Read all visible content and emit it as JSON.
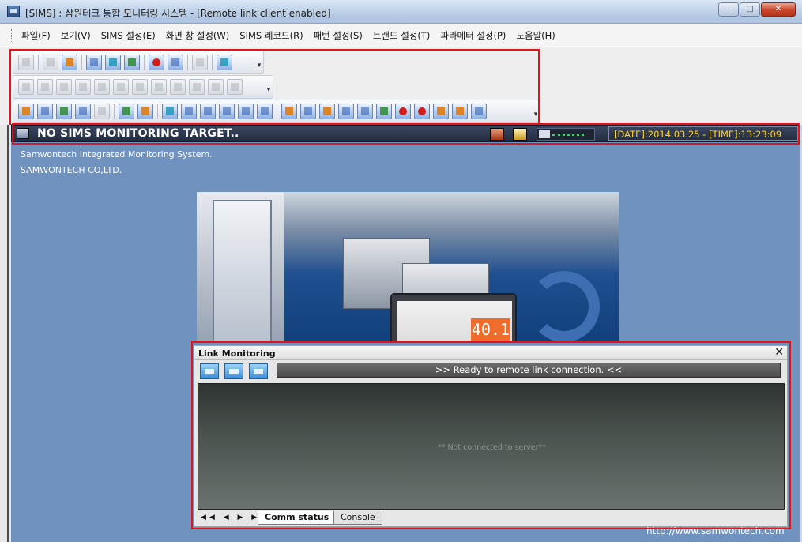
{
  "window": {
    "title": "[SIMS] : 삼원테크 통합 모니터링 시스템 - [Remote link client enabled]",
    "minimize_glyph": "–",
    "maximize_glyph": "□",
    "close_glyph": "✕"
  },
  "menu": {
    "items": [
      {
        "label": "파일(F)"
      },
      {
        "label": "보기(V)"
      },
      {
        "label": "SIMS 설정(E)"
      },
      {
        "label": "화면 창 설정(W)"
      },
      {
        "label": "SIMS 레코드(R)"
      },
      {
        "label": "패턴 설정(S)"
      },
      {
        "label": "트랜드 설정(T)"
      },
      {
        "label": "파라메터 설정(P)"
      },
      {
        "label": "도움말(H)"
      }
    ]
  },
  "toolbar": {
    "row1_icons": [
      "layout-icon",
      "copy-icon",
      "bar-chart-icon",
      "monitor-grid-icon",
      "monitor-icon",
      "wave-chart-icon",
      "record-icon",
      "text-icon",
      "tag-icon",
      "help-icon"
    ],
    "row2_icons": [
      "list-icon",
      "clock-icon",
      "print-preview-icon",
      "calc-icon",
      "graph-icon",
      "bars-icon",
      "chart-icon",
      "edit-icon",
      "search-doc-icon",
      "print-icon",
      "globe-icon",
      "rss-icon"
    ],
    "row3_icons": [
      "open-folder-icon",
      "save-icon",
      "excel-icon",
      "edit-doc-icon",
      "export-icon",
      "camera-icon",
      "folder-icon",
      "undo-icon",
      "zoom-window-icon",
      "doc-icon",
      "binoculars-icon",
      "zoom-in-icon",
      "zoom-out-icon",
      "sweep-icon",
      "signal-icon",
      "grid-icon",
      "frame-icon",
      "frame2-icon",
      "link-icon",
      "clock-square-icon",
      "clock-square2-icon",
      "bar-color-icon",
      "list-color-icon",
      "all-icon"
    ],
    "overflow_glyph": "▾"
  },
  "status": {
    "title": "NO SIMS MONITORING TARGET..",
    "datetime": "[DATE]:2014.03.25 - [TIME]:13:23:09"
  },
  "company": {
    "line1": "Samwontech Integrated Monitoring System.",
    "line2": "SAMWONTECH CO,LTD."
  },
  "hero_panel_value": "40.1",
  "website": "http://www.samwontech.com",
  "link_monitoring": {
    "title": "Link Monitoring",
    "close_glyph": "✕",
    "status_message": ">> Ready to remote link connection. <<",
    "console_message": "** Not connected to server**",
    "nav_glyphs": "◀◀ ◀ ▶ ▶▶",
    "tabs": [
      {
        "label": "Comm status",
        "active": true
      },
      {
        "label": "Console",
        "active": false
      }
    ]
  },
  "colors": {
    "highlight_box": "#e3131b",
    "main_background": "#6f92bf",
    "date_text": "#ffd22a"
  }
}
